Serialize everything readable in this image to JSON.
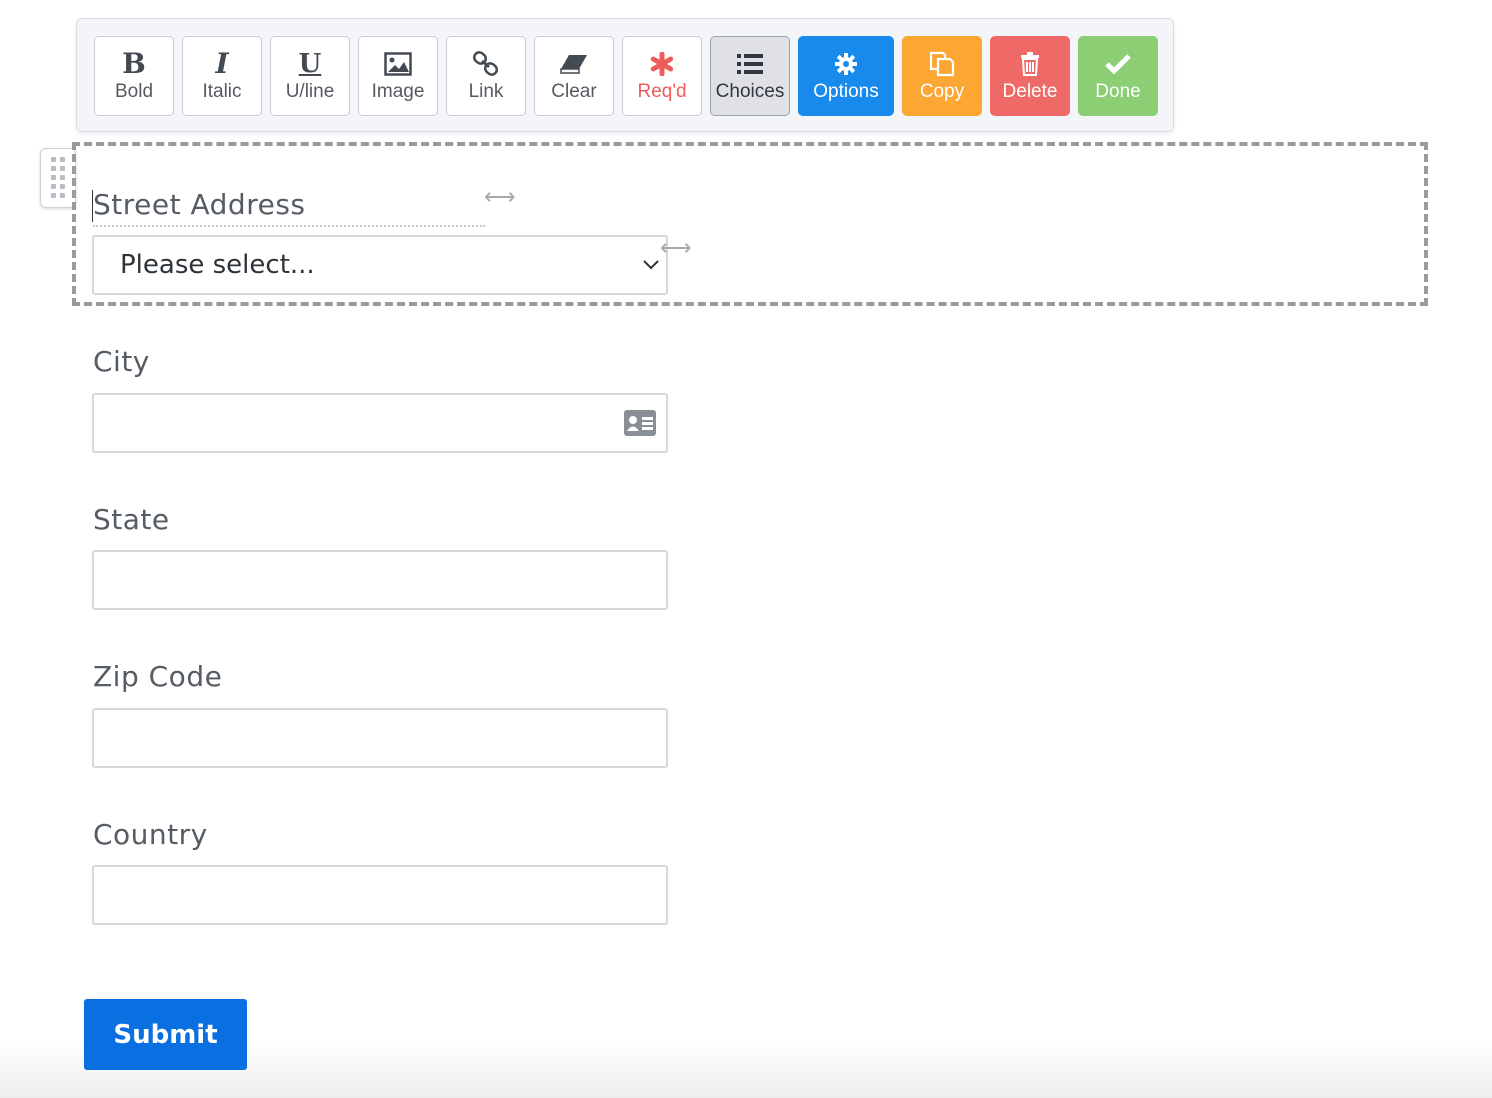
{
  "toolbar": {
    "bold": "Bold",
    "italic": "Italic",
    "underline": "U/line",
    "image": "Image",
    "link": "Link",
    "clear": "Clear",
    "required": "Req'd",
    "choices": "Choices",
    "options": "Options",
    "copy": "Copy",
    "delete": "Delete",
    "done": "Done",
    "glyph_bold": "B",
    "glyph_italic": "I",
    "glyph_underline": "U"
  },
  "colors": {
    "options": "#178aec",
    "copy": "#fca734",
    "delete": "#ef6a66",
    "done": "#8bce74",
    "required": "#ee5c5c",
    "submit": "#0a6fe0"
  },
  "form": {
    "street": {
      "label": "Street Address",
      "value": "Please select..."
    },
    "city": {
      "label": "City",
      "value": ""
    },
    "state": {
      "label": "State",
      "value": ""
    },
    "zip": {
      "label": "Zip Code",
      "value": ""
    },
    "country": {
      "label": "Country",
      "value": ""
    }
  },
  "submit_label": "Submit",
  "icons": {
    "bold": "bold-icon",
    "italic": "italic-icon",
    "underline": "underline-icon",
    "image": "image-icon",
    "link": "link-icon",
    "clear": "eraser-icon",
    "required": "asterisk-icon",
    "choices": "list-icon",
    "options": "gear-icon",
    "copy": "copy-icon",
    "delete": "trash-icon",
    "done": "check-icon",
    "city": "contact-card-icon",
    "select": "chevron-down-icon"
  }
}
